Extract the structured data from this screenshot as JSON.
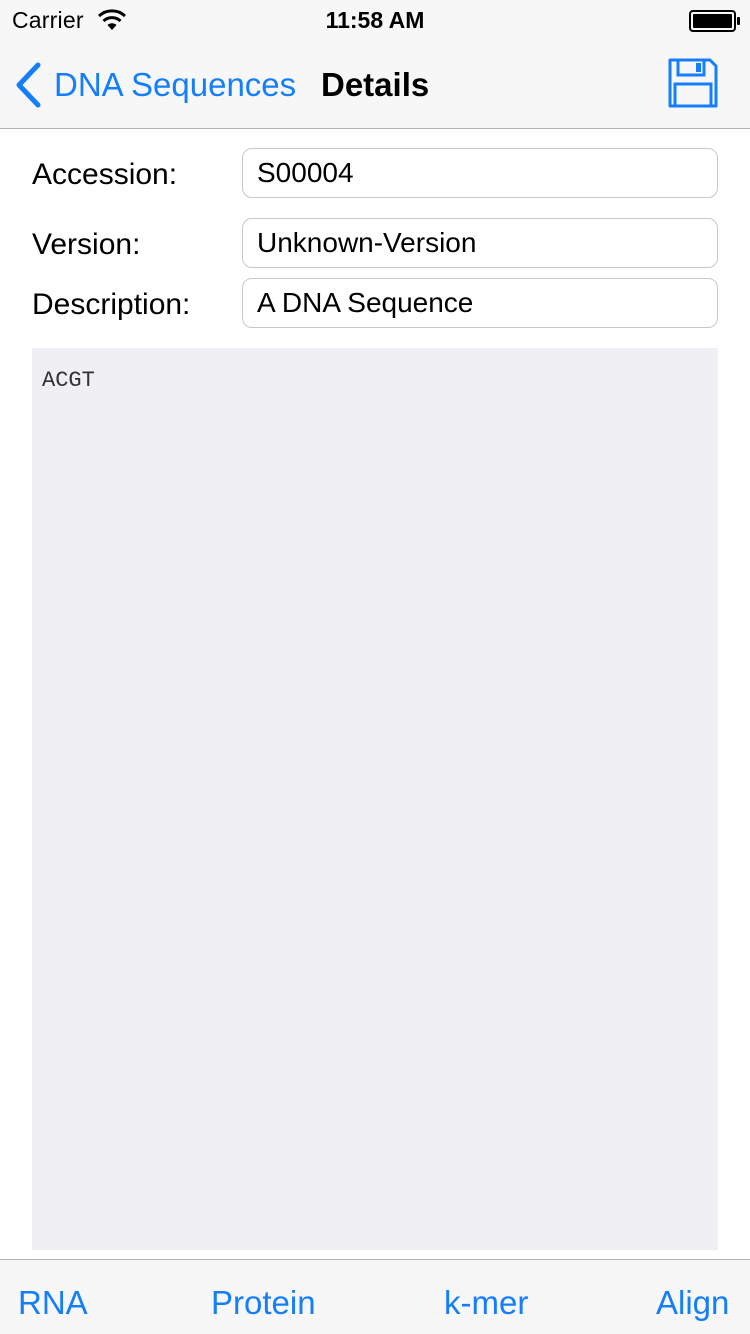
{
  "status_bar": {
    "carrier": "Carrier",
    "time": "11:58 AM",
    "icons": [
      "wifi-icon",
      "battery-icon"
    ]
  },
  "nav": {
    "back_label": "DNA Sequences",
    "title": "Details",
    "save_icon": "floppy-disk-icon"
  },
  "form": {
    "accession": {
      "label": "Accession:",
      "value": "S00004"
    },
    "version": {
      "label": "Version:",
      "value": "Unknown-Version"
    },
    "description": {
      "label": "Description:",
      "value": "A DNA Sequence"
    }
  },
  "sequence": "ACGT",
  "toolbar": {
    "rna": "RNA",
    "protein": "Protein",
    "kmer": "k-mer",
    "align": "Align"
  },
  "colors": {
    "accent": "#157efb",
    "bar_background": "#f7f7f7",
    "sequence_background": "#efeff4"
  }
}
